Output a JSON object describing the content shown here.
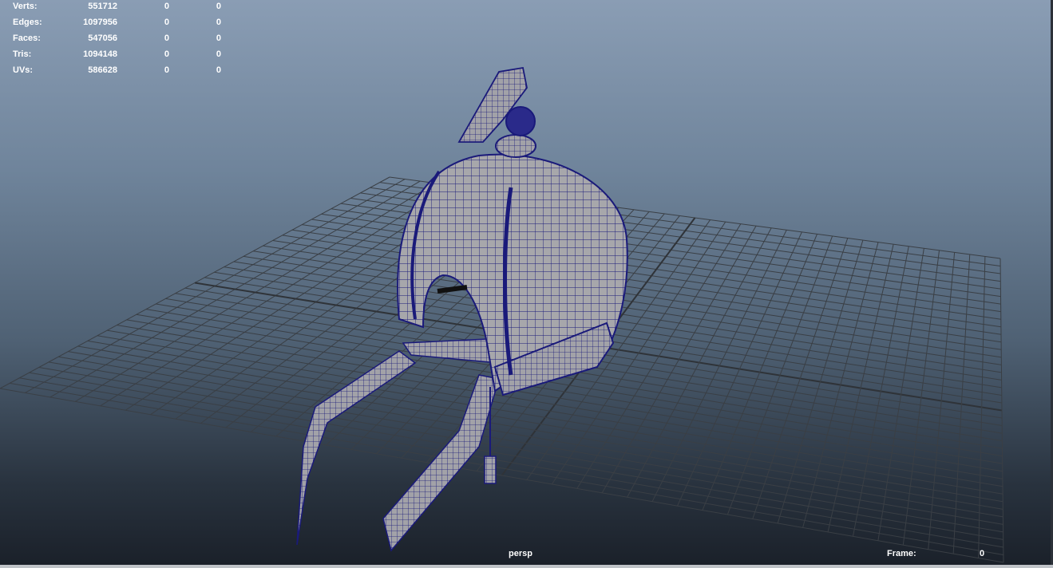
{
  "hud": {
    "stats": [
      {
        "label": "Verts:",
        "values": [
          "551712",
          "0",
          "0"
        ]
      },
      {
        "label": "Edges:",
        "values": [
          "1097956",
          "0",
          "0"
        ]
      },
      {
        "label": "Faces:",
        "values": [
          "547056",
          "0",
          "0"
        ]
      },
      {
        "label": "Tris:",
        "values": [
          "1094148",
          "0",
          "0"
        ]
      },
      {
        "label": "UVs:",
        "values": [
          "586628",
          "0",
          "0"
        ]
      }
    ],
    "camera": "persp",
    "frame_label": "Frame:",
    "frame_value": "0"
  },
  "colors": {
    "wireframe": "#1a1a7a",
    "mesh_fill": "#a7a7ab",
    "grid": "#3a3f45",
    "bg_top": "#8a9db4",
    "bg_bottom": "#1a2029"
  },
  "viewport": {
    "object": "helmet-model",
    "view": "perspective",
    "grid_visible": true,
    "display_mode": "wireframe-on-shaded"
  }
}
